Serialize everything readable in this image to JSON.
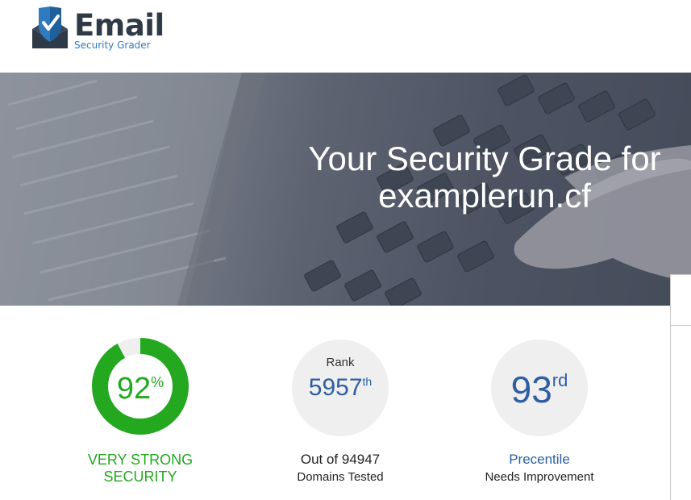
{
  "brand": {
    "name": "Email",
    "tagline": "Security Grader",
    "colors": {
      "dark": "#2f3a48",
      "accent": "#2f7bbf"
    }
  },
  "hero": {
    "title_line1": "Your Security Grade for",
    "title_line2": "examplerun.cf"
  },
  "grade": {
    "value": "92",
    "suffix": "%",
    "percent": 92,
    "label_line1": "VERY STRONG",
    "label_line2": "SECURITY",
    "color": "#23a81f"
  },
  "rank": {
    "label": "Rank",
    "value": "5957",
    "suffix": "th",
    "caption_line1": "Out of 94947",
    "caption_line2": "Domains Tested"
  },
  "percentile": {
    "value": "93",
    "suffix": "rd",
    "caption_line1": "Precentile",
    "caption_line2": "Needs Improvement"
  },
  "colors": {
    "blue": "#2e5ea3",
    "circle_bg": "#efefef"
  }
}
